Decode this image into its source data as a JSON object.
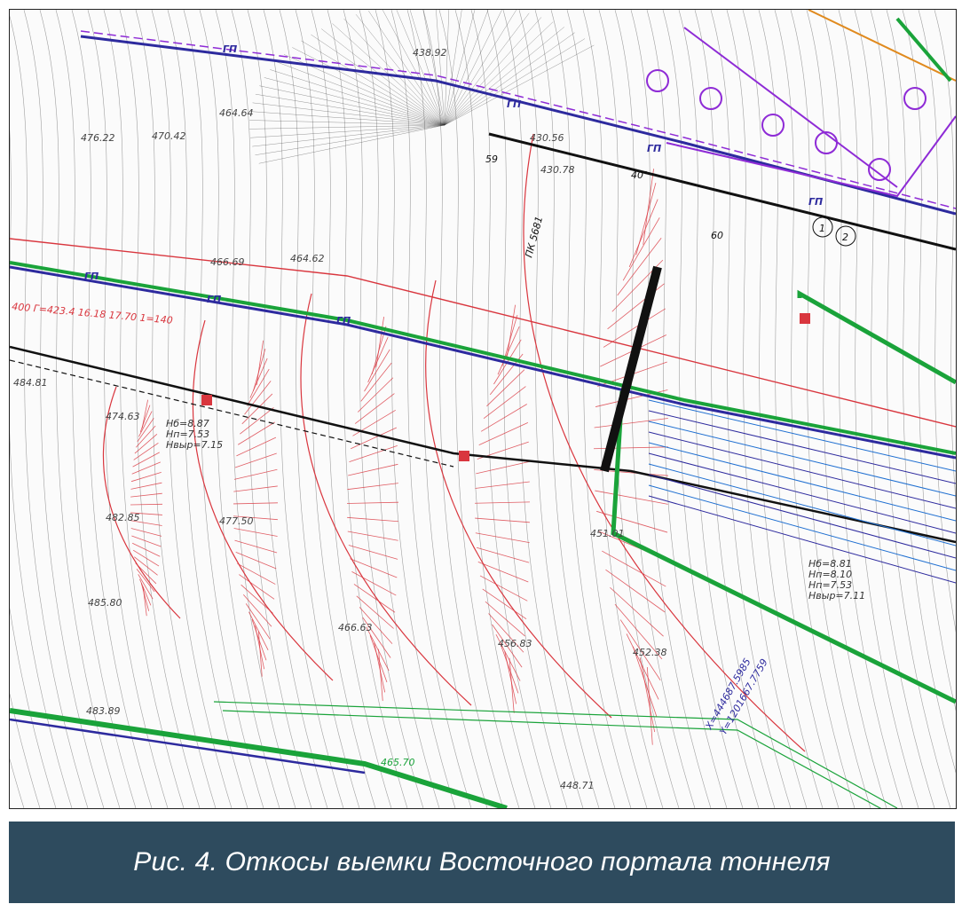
{
  "caption": "Рис. 4. Откосы выемки Восточного портала тоннеля",
  "colors": {
    "caption_bg": "#2e4b5e",
    "caption_text": "#ffffff",
    "contour": "#555555",
    "slope_hatch": "#d9363e",
    "gas_line": "#2d2a9e",
    "green_line": "#1aa33a",
    "purple_line": "#8e2bd6",
    "black_line": "#111111",
    "orange_line": "#e08a1e"
  },
  "map": {
    "labels": {
      "km": "ПК 5681",
      "gp_marker": "ГП",
      "num_59": "59",
      "num_60": "60",
      "circ_1": "1",
      "circ_2": "2",
      "angle": "40°",
      "elev_1": "476.22",
      "elev_2": "470.42",
      "elev_3": "464.64",
      "elev_4": "466.69",
      "elev_5": "464.62",
      "elev_6": "474.63",
      "elev_7": "482.85",
      "elev_8": "485.80",
      "elev_9": "477.50",
      "elev_10": "466.63",
      "elev_11": "456.83",
      "elev_12": "451.01",
      "elev_13": "452.38",
      "elev_14": "483.89",
      "elev_15": "465.70",
      "elev_16": "448.71",
      "elev_17": "430.56",
      "elev_18": "430.78",
      "elev_19": "438.92",
      "elev_20": "484.81",
      "hatch_note_1": "Нб=8.87",
      "hatch_note_2": "Нп=7.53",
      "hatch_note_3": "Нвыр=7.15",
      "hatch_note_4": "Нб=8.81",
      "hatch_note_5": "Нп=8.10",
      "hatch_note_6": "Нп=7.53",
      "hatch_note_7": "Нвыр=7.11",
      "red_text": "400 Г=423.4 16.18 17.70 1=140",
      "coord_1": "Х=444687.5985",
      "coord_2": "Y=1201667.7759"
    }
  }
}
